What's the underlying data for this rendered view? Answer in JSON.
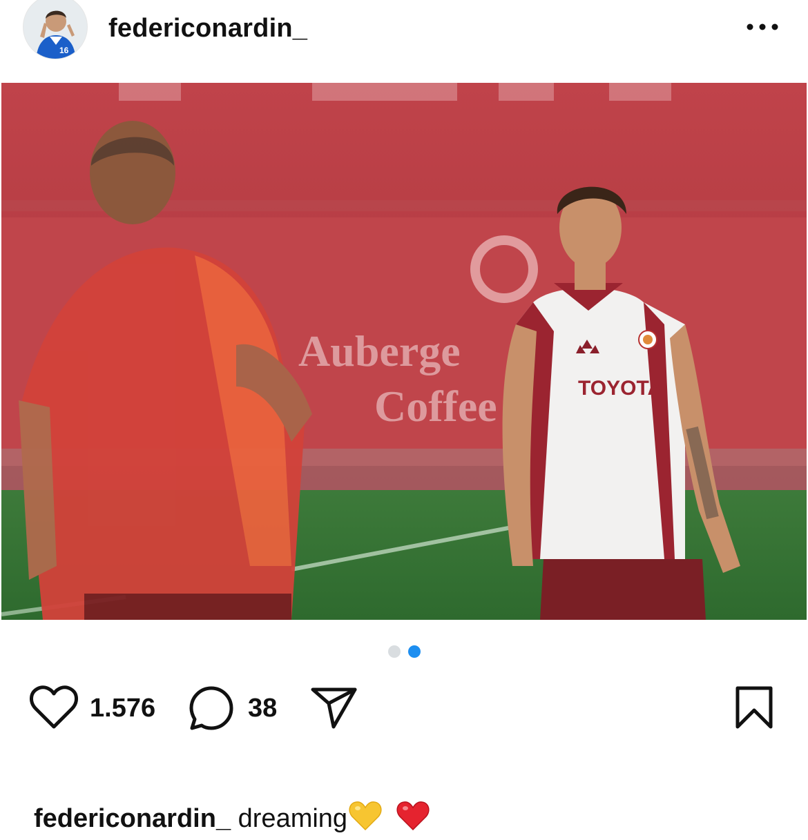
{
  "post": {
    "username": "federiconardin_",
    "photo": {
      "banner_text_line1": "Auberge",
      "banner_text_line2": "Coffee",
      "jersey_text": "TOYOTA"
    },
    "carousel": {
      "total": 2,
      "active_index": 1
    },
    "likes_count": "1.576",
    "comments_count": "38",
    "caption": {
      "username": "federiconardin_",
      "text": "dreaming"
    }
  },
  "icons": {
    "more": "more-horizontal-icon",
    "like": "heart-outline-icon",
    "comment": "comment-bubble-icon",
    "share": "paper-plane-icon",
    "save": "bookmark-icon",
    "emoji1": "yellow-heart-emoji",
    "emoji2": "red-heart-emoji"
  },
  "colors": {
    "accent_blue": "#1d8ef0",
    "inactive_dot": "#d9dde0",
    "text": "#111111",
    "banner_red": "#b93a40"
  }
}
